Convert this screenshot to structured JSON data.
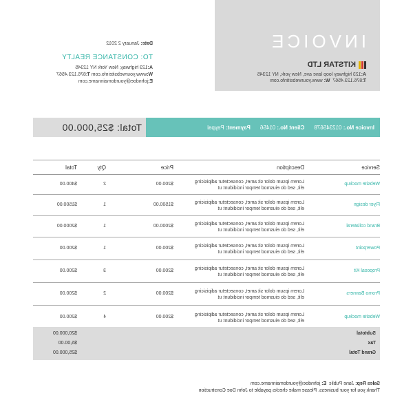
{
  "header": {
    "title": "INVOICE",
    "company_name": "KITSTAR LTD",
    "company_logo_colors": [
      "#e2b400",
      "#d23a2a",
      "#333333"
    ],
    "company_address_label": "A:",
    "company_address": "123 highway loop lane ave, New york, NY 12345",
    "company_phone_label": "T:",
    "company_phone": "876.123.4567",
    "company_web_label": "W:",
    "company_web": "www.yourwebsitinfo.com"
  },
  "bill_to": {
    "date_label": "Date:",
    "date": "January 2 2012",
    "to_label": "TO: CONSTANCE REALTY",
    "address_label": "A:",
    "address": "123 highway, New York NY 12345",
    "web_label": "W:",
    "web": "www.yourwebsiteinfo.com",
    "phone_label": "T:",
    "phone": "876.123.4567",
    "email_label": "E:",
    "email": "johndoe@yourdomainname.com"
  },
  "info_bar": {
    "invoice_label": "Invoice No.:",
    "invoice_no": "012345678",
    "client_label": "Client No.:",
    "client_no": "01456",
    "payment_label": "Payment:",
    "payment": "Paypal",
    "total_label": "Total:",
    "total": "$25,000.00"
  },
  "table": {
    "headers": {
      "service": "Service",
      "description": "Description",
      "price": "Price",
      "qty": "Qty",
      "total": "Total"
    },
    "rows": [
      {
        "service": "Website mockup",
        "desc1": "Lorem ipsum dolor sit amet, consectetur adipisicing",
        "desc2": "elit, sed do eiusmod tempor incididunt ut",
        "price": "$200.00",
        "qty": "2",
        "total": "$400.00"
      },
      {
        "service": "Flyer design",
        "desc1": "Lorem ipsum dolor sit amet, consectetur adipisicing",
        "desc2": "elit, sed do eiusmod tempor incididunt ut",
        "price": "$1500.00",
        "qty": "1",
        "total": "$1500.00"
      },
      {
        "service": "Brand collateral",
        "desc1": "Lorem ipsum dolor sit amet, consectetur adipisicing",
        "desc2": "elit, sed do eiusmod tempor incididunt ut",
        "price": "$2000.00",
        "qty": "1",
        "total": "$2000.00"
      },
      {
        "service": "Powerpoint",
        "desc1": "Lorem ipsum dolor sit amet, consectetur adipisicing",
        "desc2": "elit, sed do eiusmod tempor incididunt ut",
        "price": "$200.00",
        "qty": "1",
        "total": "$200.00"
      },
      {
        "service": "Proposal Kit",
        "desc1": "Lorem ipsum dolor sit amet, consectetur adipisicing",
        "desc2": "elit, sed do eiusmod tempor incididunt ut",
        "price": "$200.00",
        "qty": "3",
        "total": "$200.00"
      },
      {
        "service": "Promo Banners",
        "desc1": "Lorem ipsum dolor sit amet, consectetur adipisicing",
        "desc2": "elit, sed do eiusmod tempor incididunt ut",
        "price": "$200.00",
        "qty": "2",
        "total": "$200.00"
      },
      {
        "service": "Website mockup",
        "desc1": "Lorem ipsum dolor sit amet, consectetur adipisicing",
        "desc2": "elit, sed do eiusmod tempor incididunt ut",
        "price": "$200.00",
        "qty": "4",
        "total": "$200.00"
      }
    ]
  },
  "totals": {
    "subtotal_label": "Subtotal",
    "subtotal": "$20,000.00",
    "tax_label": "Tax",
    "tax": "$5,00.00",
    "grand_label": "Grand Total",
    "grand": "$25,000.00"
  },
  "footer": {
    "sales_rep_label": "Sales Rep:",
    "sales_rep": "Jane Public",
    "email_label": "E:",
    "email": "johndoe@yourdomainname.com",
    "thanks": "Thank you for your business. Please make checks payable to John Doe Construction"
  },
  "colors": {
    "accent": "#67c2b9",
    "accent_text": "#35b5a8",
    "grey": "#d9d9d9"
  }
}
